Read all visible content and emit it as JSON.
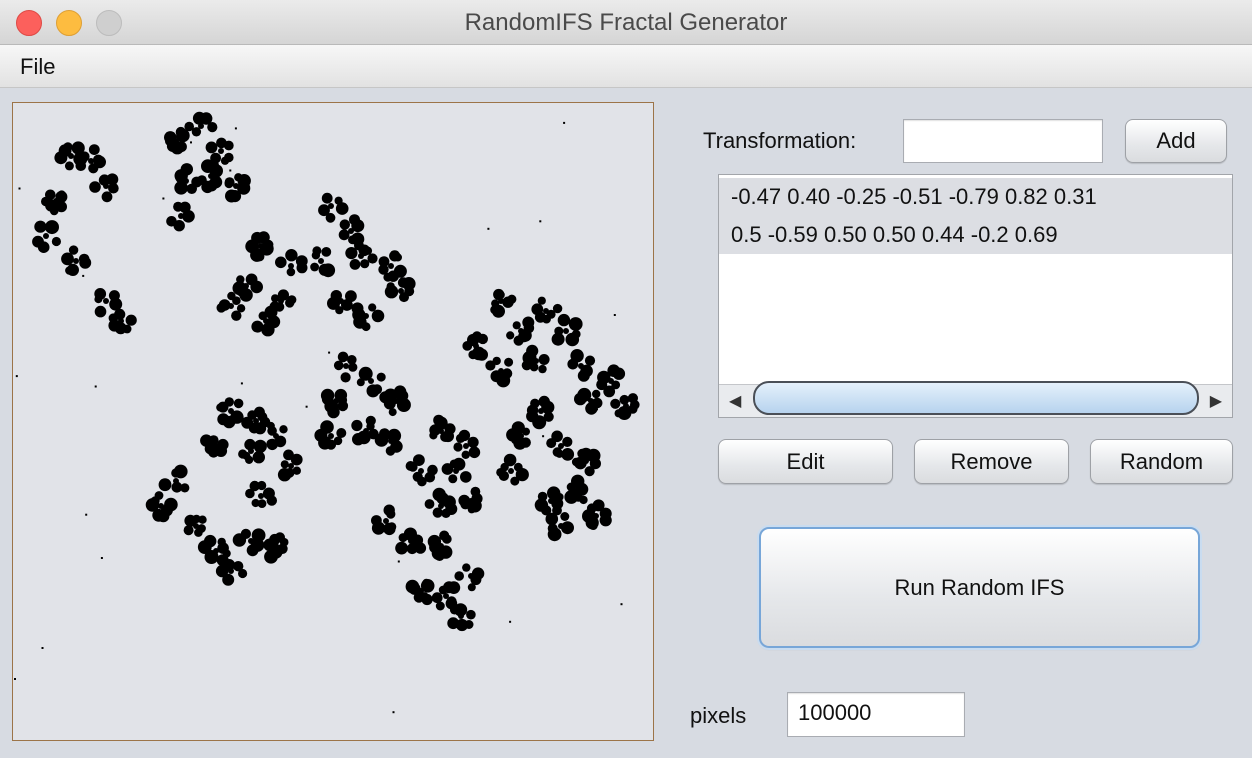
{
  "window": {
    "title": "RandomIFS Fractal Generator"
  },
  "menu": {
    "file": "File"
  },
  "controls": {
    "transformation_label": "Transformation:",
    "transformation_value": "",
    "add_label": "Add",
    "transforms": [
      "-0.47 0.40 -0.25 -0.51 -0.79 0.82 0.31",
      "0.5 -0.59 0.50 0.50 0.44 -0.2 0.69"
    ],
    "edit_label": "Edit",
    "remove_label": "Remove",
    "random_label": "Random",
    "run_label": "Run Random IFS",
    "pixels_label": "pixels",
    "pixels_value": "100000"
  },
  "icons": {
    "scroll_left": "scroll-left-arrow-icon",
    "scroll_right": "scroll-right-arrow-icon"
  },
  "colors": {
    "fractal": "#000000",
    "canvas_bg": "#e1e3e8",
    "close": "#fc605c",
    "minimize": "#fdbc40",
    "maximize": "#cfcfcf",
    "focus": "#77a6d8"
  }
}
